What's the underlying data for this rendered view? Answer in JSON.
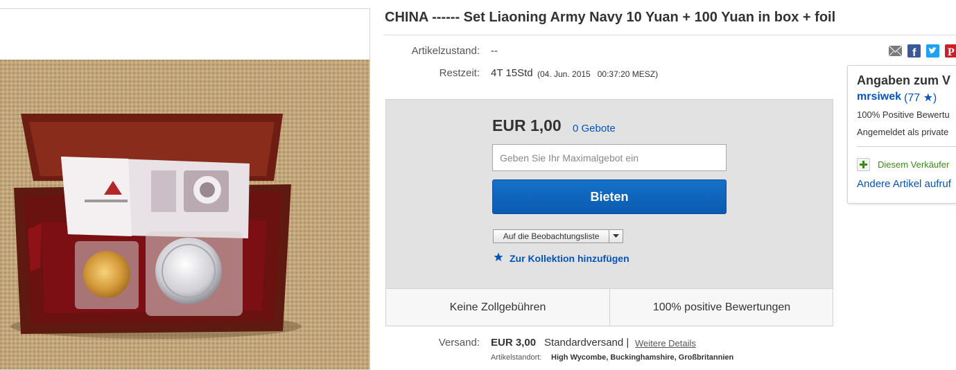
{
  "item": {
    "title": "CHINA ------ Set Liaoning Army Navy 10 Yuan + 100 Yuan in box + foil"
  },
  "details": {
    "condition_label": "Artikelzustand:",
    "condition_value": "--",
    "time_label": "Restzeit:",
    "time_left": "4T 15Std",
    "end_date": "(04. Jun. 2015   00:37:20 MESZ)"
  },
  "share": {
    "icons": [
      "email-icon",
      "facebook-icon",
      "twitter-icon",
      "pinterest-icon"
    ],
    "colors": {
      "email": "#7a7a7a",
      "facebook": "#3b5998",
      "twitter": "#1da1f2",
      "pinterest": "#cb2027"
    }
  },
  "bid": {
    "price": "EUR 1,00",
    "bids_count": "0 Gebote",
    "max_bid_placeholder": "Geben Sie Ihr Maximalgebot ein",
    "button_label": "Bieten",
    "watchlist_label": "Auf die Beobachtungsliste",
    "collection_label": "Zur Kollektion hinzufügen"
  },
  "badges": {
    "no_customs": "Keine Zollgebühren",
    "positive_ratings": "100% positive Bewertungen"
  },
  "shipping": {
    "label": "Versand:",
    "price": "EUR 3,00",
    "type": "Standardversand |",
    "details_link": "Weitere Details",
    "location_label": "Artikelstandort:",
    "location": "High Wycombe, Buckinghamshire, Großbritannien"
  },
  "seller": {
    "heading": "Angaben zum V",
    "name": "mrsiwek",
    "score": "(77 ★)",
    "positive": "100% Positive Bewertu",
    "registered": "Angemeldet als private",
    "follow": "Diesem Verkäufer",
    "other_items": "Andere Artikel aufruf"
  },
  "colors": {
    "accent_blue": "#0654ba",
    "bid_button": "#0f63bd",
    "follow_green": "#3a8a1a"
  }
}
